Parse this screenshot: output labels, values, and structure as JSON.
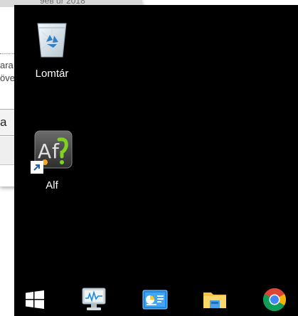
{
  "background_window": {
    "title_fragment": "9ев ur 2018",
    "line1": "ara",
    "line2": "övе",
    "combo_text": "a"
  },
  "desktop": {
    "icons": [
      {
        "label": "Lomtár",
        "icon": "recycle-bin-icon"
      },
      {
        "label": "Alf",
        "icon": "alf-app-icon",
        "shortcut": true
      }
    ]
  },
  "taskbar": {
    "buttons": [
      {
        "name": "start",
        "icon": "windows-logo-icon"
      },
      {
        "name": "performance-monitor",
        "icon": "monitor-chart-icon"
      },
      {
        "name": "control-panel",
        "icon": "control-panel-icon"
      },
      {
        "name": "file-explorer",
        "icon": "folder-icon"
      },
      {
        "name": "chrome",
        "icon": "chrome-icon"
      }
    ]
  },
  "colors": {
    "desktop_bg": "#000000",
    "start_icon": "#ffffff",
    "folder_yellow": "#f6c344",
    "chrome_red": "#db4437",
    "chrome_yellow": "#f4b400",
    "chrome_green": "#0f9d58",
    "chrome_blue": "#4285f4"
  }
}
